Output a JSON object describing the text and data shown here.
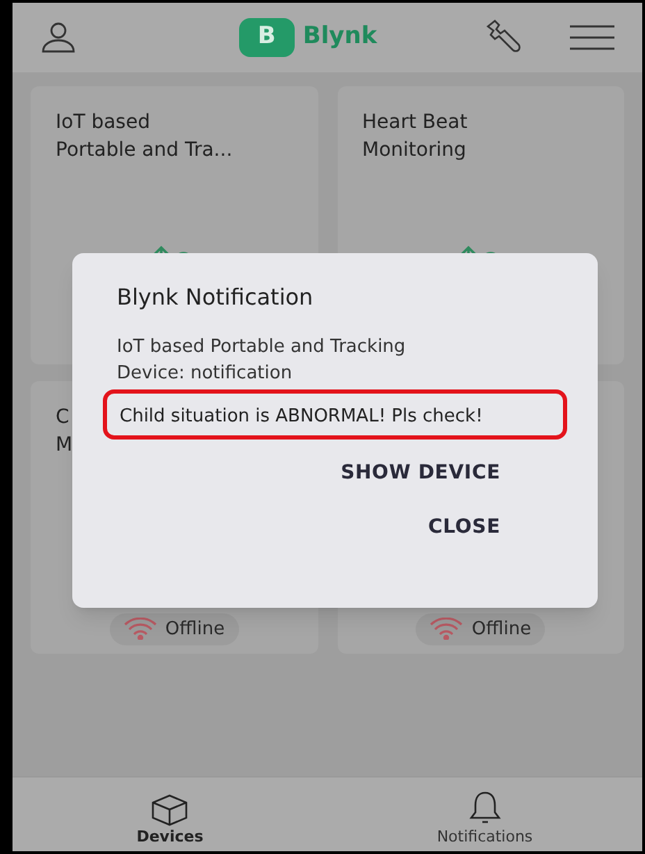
{
  "header": {
    "logo_letter": "B",
    "brand": "Blynk"
  },
  "devices": [
    {
      "title_lines": [
        "IoT based",
        "Portable and Tra..."
      ]
    },
    {
      "title_lines": [
        "Heart Beat",
        "Monitoring"
      ]
    },
    {
      "title_lines": [
        "C",
        "M"
      ],
      "status": "Offline"
    },
    {
      "status": "Offline"
    }
  ],
  "dialog": {
    "title": "Blynk Notification",
    "message": "IoT based Portable and Tracking Device: notification",
    "highlight": "Child situation is ABNORMAL! Pls check!",
    "actions": [
      "SHOW DEVICE",
      "CLOSE"
    ]
  },
  "nav": [
    {
      "label": "Devices",
      "kind": "devices",
      "selected": true
    },
    {
      "label": "Notifications",
      "kind": "notifications",
      "selected": false
    }
  ]
}
